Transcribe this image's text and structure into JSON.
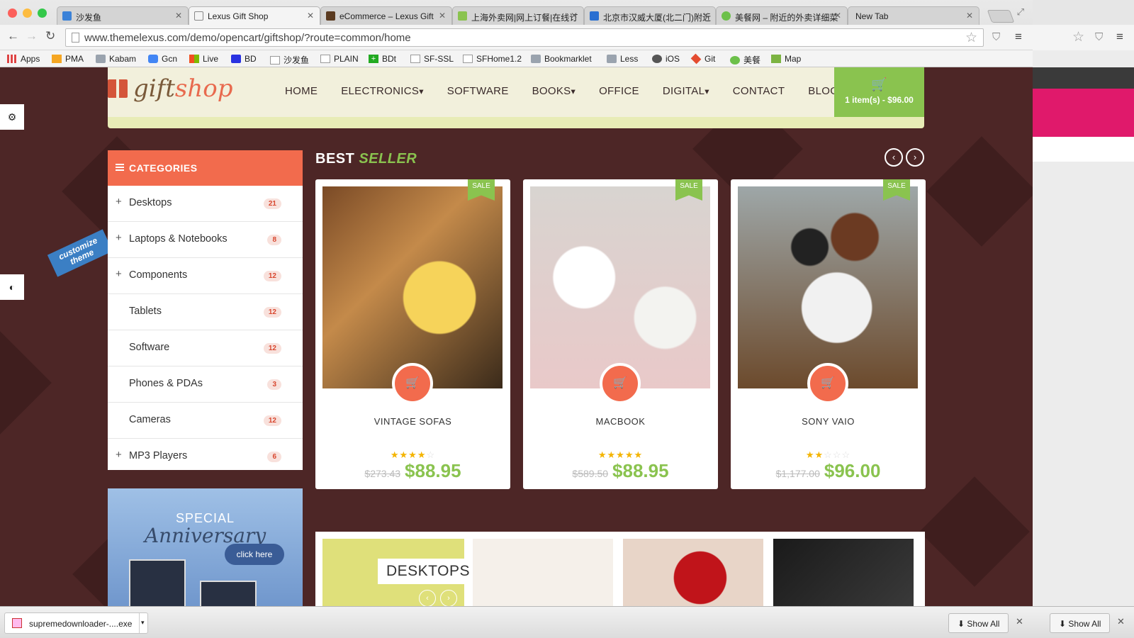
{
  "browser": {
    "tabs": [
      {
        "title": "沙发鱼",
        "color": "#3b82d8"
      },
      {
        "title": "Lexus Gift Shop",
        "color": "#888888"
      },
      {
        "title": "eCommerce – Lexus Gift",
        "color": "#5a3a20"
      },
      {
        "title": "上海外卖网|网上订餐|在线订",
        "color": "#8ac34f"
      },
      {
        "title": "北京市汉威大厦(北二门)附近",
        "color": "#2a6fd1"
      },
      {
        "title": "美餐网 – 附近的外卖详细菜",
        "color": "#6cc04a"
      },
      {
        "title": "New Tab",
        "color": ""
      }
    ],
    "url": "www.themelexus.com/demo/opencart/giftshop/?route=common/home",
    "bookmarks": [
      "Apps",
      "PMA",
      "Kabam",
      "Gcn",
      "Live",
      "BD",
      "沙发鱼",
      "PLAIN",
      "BDt",
      "SF-SSL",
      "SFHome1.2",
      "Bookmarklet",
      "Less",
      "iOS",
      "Git",
      "美餐",
      "Map"
    ]
  },
  "site": {
    "logo_gift": "gift",
    "logo_shop": "shop",
    "nav": [
      "HOME",
      "ELECTRONICS",
      "SOFTWARE",
      "BOOKS",
      "OFFICE",
      "DIGITAL",
      "CONTACT",
      "BLOG"
    ],
    "cart_label": "1 item(s) - $96.00",
    "customize_tag": "customize theme",
    "categories_title": "CATEGORIES",
    "categories": [
      {
        "name": "Desktops",
        "count": "21",
        "plus": true
      },
      {
        "name": "Laptops & Notebooks",
        "count": "8",
        "plus": true
      },
      {
        "name": "Components",
        "count": "12",
        "plus": true
      },
      {
        "name": "Tablets",
        "count": "12",
        "plus": false
      },
      {
        "name": "Software",
        "count": "12",
        "plus": false
      },
      {
        "name": "Phones & PDAs",
        "count": "3",
        "plus": false
      },
      {
        "name": "Cameras",
        "count": "12",
        "plus": false
      },
      {
        "name": "MP3 Players",
        "count": "6",
        "plus": true
      }
    ],
    "promo": {
      "line1": "SPECIAL",
      "line2": "Anniversary",
      "button": "click here"
    },
    "best_seller": {
      "best": "BEST",
      "seller": "SELLER"
    },
    "products": [
      {
        "name": "VINTAGE SOFAS",
        "rating": 4,
        "old_price": "$273.43",
        "price": "$88.95",
        "sale": "SALE"
      },
      {
        "name": "MACBOOK",
        "rating": 5,
        "old_price": "$589.50",
        "price": "$88.95",
        "sale": "SALE"
      },
      {
        "name": "SONY VAIO",
        "rating": 2,
        "old_price": "$1,177.00",
        "price": "$96.00",
        "sale": "SALE"
      }
    ],
    "desktops_label": "DESKTOPS"
  },
  "downloads": {
    "file": "supremedownloader-....exe",
    "show_all": "Show All"
  },
  "colors": {
    "accent": "#f26b4d",
    "green": "#8ac34f",
    "bg": "#4d2626"
  }
}
